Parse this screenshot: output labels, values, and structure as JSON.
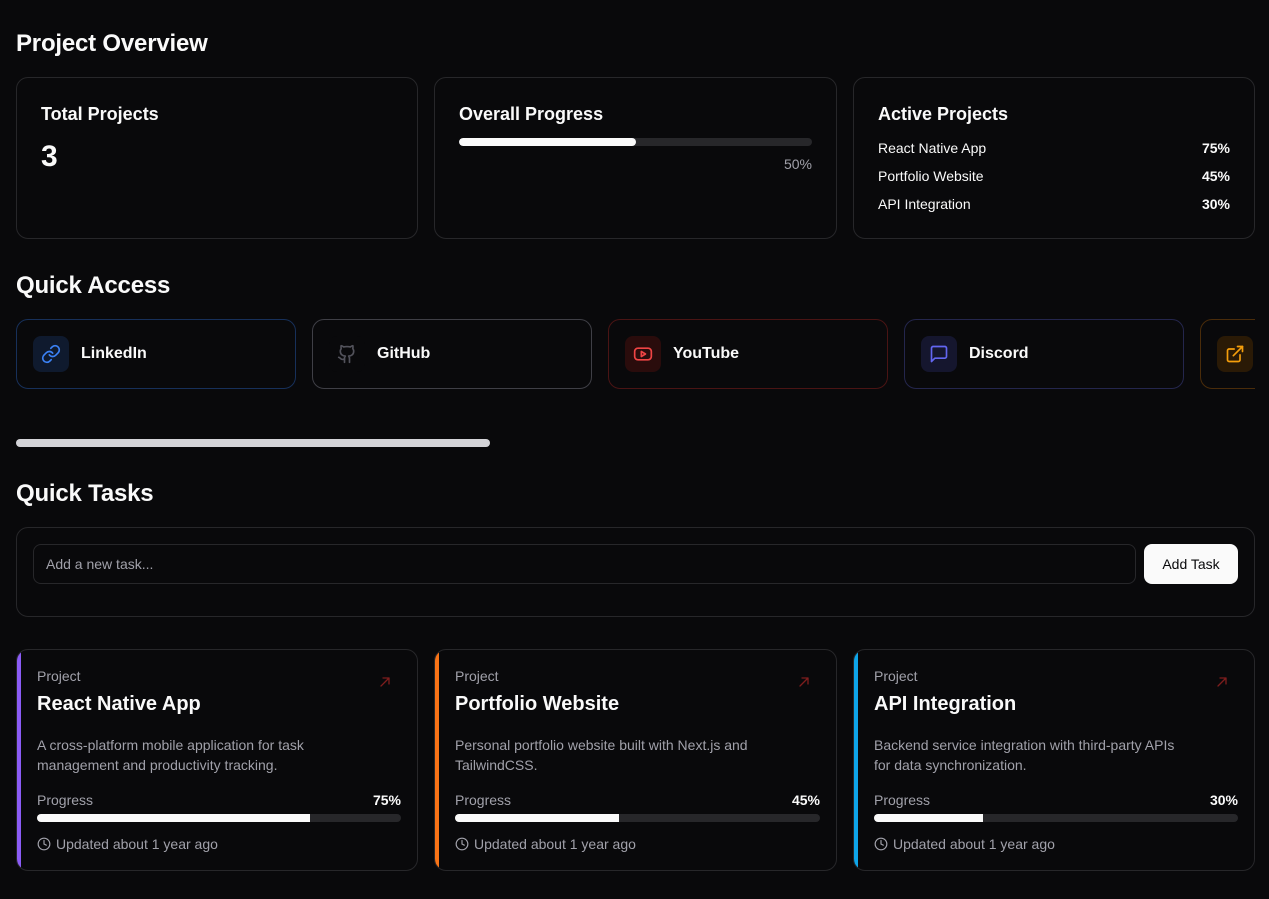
{
  "overview": {
    "title": "Project Overview",
    "total": {
      "label": "Total Projects",
      "value": "3"
    },
    "progress": {
      "label": "Overall Progress",
      "percent_text": "50%",
      "percent": 50
    },
    "active": {
      "label": "Active Projects",
      "items": [
        {
          "name": "React Native App",
          "pct": "75%"
        },
        {
          "name": "Portfolio Website",
          "pct": "45%"
        },
        {
          "name": "API Integration",
          "pct": "30%"
        }
      ]
    }
  },
  "quick_access": {
    "title": "Quick Access",
    "links": [
      {
        "label": "LinkedIn",
        "icon": "link-icon",
        "color": "#3b82f6"
      },
      {
        "label": "GitHub",
        "icon": "github-icon",
        "color": "#71717a"
      },
      {
        "label": "YouTube",
        "icon": "youtube-icon",
        "color": "#ef4444"
      },
      {
        "label": "Discord",
        "icon": "message-square-icon",
        "color": "#6366f1"
      },
      {
        "label": "",
        "icon": "external-link-icon",
        "color": "#f59e0b"
      }
    ],
    "scroll_fraction": 0.38
  },
  "tasks": {
    "title": "Quick Tasks",
    "input_placeholder": "Add a new task...",
    "add_label": "Add Task"
  },
  "projects": [
    {
      "kicker": "Project",
      "name": "React Native App",
      "description": "A cross-platform mobile application for task management and productivity tracking.",
      "progress_label": "Progress",
      "progress_text": "75%",
      "progress": 75,
      "updated": "Updated about 1 year ago",
      "accent": "#8b5cf6"
    },
    {
      "kicker": "Project",
      "name": "Portfolio Website",
      "description": "Personal portfolio website built with Next.js and TailwindCSS.",
      "progress_label": "Progress",
      "progress_text": "45%",
      "progress": 45,
      "updated": "Updated about 1 year ago",
      "accent": "#f97316"
    },
    {
      "kicker": "Project",
      "name": "API Integration",
      "description": "Backend service integration with third-party APIs for data synchronization.",
      "progress_label": "Progress",
      "progress_text": "30%",
      "progress": 30,
      "updated": "Updated about 1 year ago",
      "accent": "#0ea5e9"
    }
  ]
}
